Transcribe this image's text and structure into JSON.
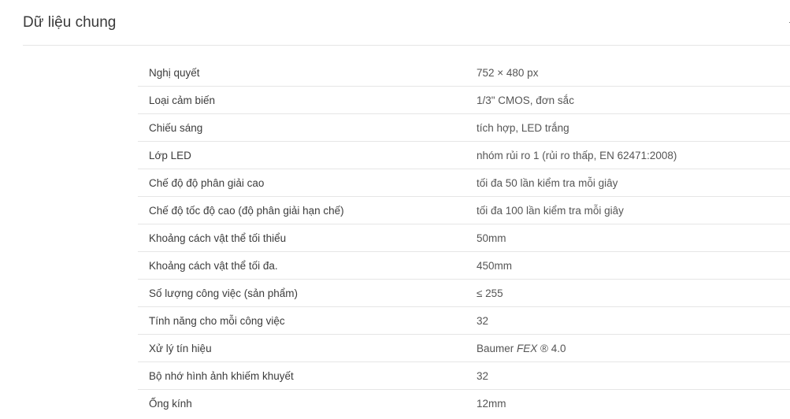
{
  "section": {
    "title": "Dữ liệu chung",
    "toggle_icon": "collapse-icon"
  },
  "specs": [
    {
      "label": "Nghị quyết",
      "value": "752 × 480 px"
    },
    {
      "label": "Loại cảm biến",
      "value": "1/3\" CMOS, đơn sắc"
    },
    {
      "label": "Chiếu sáng",
      "value": "tích hợp, LED trắng"
    },
    {
      "label": "Lớp LED",
      "value": "nhóm rủi ro 1 (rủi ro thấp, EN 62471:2008)"
    },
    {
      "label": "Chế độ độ phân giải cao",
      "value": "tối đa 50 lần kiểm tra mỗi giây"
    },
    {
      "label": "Chế độ tốc độ cao (độ phân giải hạn chế)",
      "value": "tối đa 100 lần kiểm tra mỗi giây"
    },
    {
      "label": "Khoảng cách vật thể tối thiểu",
      "value": "50mm"
    },
    {
      "label": "Khoảng cách vật thể tối đa.",
      "value": "450mm"
    },
    {
      "label": "Số lượng công việc (sản phẩm)",
      "value": "≤ 255"
    },
    {
      "label": "Tính năng cho mỗi công việc",
      "value": "32"
    },
    {
      "label": "Xử lý tín hiệu",
      "value_prefix": "Baumer ",
      "value_italic": "FEX",
      "value_suffix": " ® 4.0"
    },
    {
      "label": "Bộ nhớ hình ảnh khiếm khuyết",
      "value": "32"
    },
    {
      "label": "Ống kính",
      "value": "12mm"
    }
  ]
}
